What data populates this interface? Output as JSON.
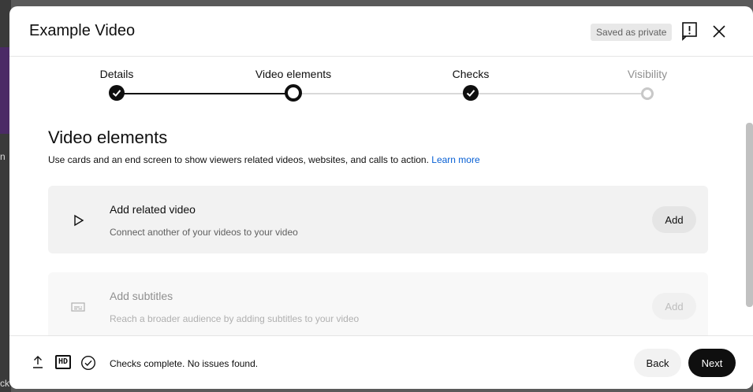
{
  "backdrop": {
    "fragments": [
      "n",
      "ck"
    ]
  },
  "header": {
    "title": "Example Video",
    "saved_badge": "Saved as private",
    "icons": {
      "feedback": "feedback-exclamation-icon",
      "close": "close-x-icon"
    }
  },
  "stepper": {
    "steps": [
      {
        "label": "Details",
        "state": "done"
      },
      {
        "label": "Video elements",
        "state": "current"
      },
      {
        "label": "Checks",
        "state": "done"
      },
      {
        "label": "Visibility",
        "state": "future"
      }
    ]
  },
  "section": {
    "title": "Video elements",
    "description": "Use cards and an end screen to show viewers related videos, websites, and calls to action.",
    "learn_more": "Learn more"
  },
  "cards": [
    {
      "title": "Add related video",
      "description": "Connect another of your videos to your video",
      "button": "Add",
      "icon": "play-outline-icon",
      "enabled": true
    },
    {
      "title": "Add subtitles",
      "description": "Reach a broader audience by adding subtitles to your video",
      "button": "Add",
      "icon": "subtitles-icon",
      "enabled": false
    }
  ],
  "footer": {
    "status": "Checks complete. No issues found.",
    "hd_label": "HD",
    "back": "Back",
    "next": "Next",
    "icons": [
      "upload-icon",
      "hd-icon",
      "check-circle-icon"
    ]
  },
  "colors": {
    "accent_link": "#065fd4",
    "primary_button": "#0f0f0f",
    "card_background": "#f2f2f2"
  }
}
